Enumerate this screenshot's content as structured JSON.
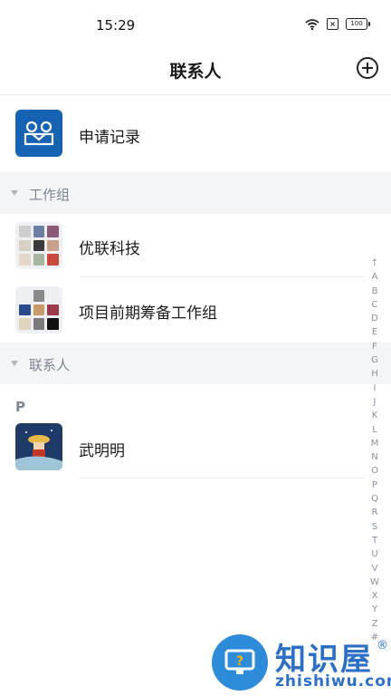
{
  "status_bar": {
    "time": "15:29",
    "battery": "100"
  },
  "header": {
    "title": "联系人"
  },
  "apply_record": {
    "label": "申请记录"
  },
  "sections": {
    "work_groups": {
      "title": "工作组"
    },
    "contacts": {
      "title": "联系人"
    }
  },
  "groups": [
    {
      "name": "优联科技"
    },
    {
      "name": "项目前期筹备工作组"
    }
  ],
  "contact_index_letter": "P",
  "contacts": [
    {
      "name": "武明明"
    }
  ],
  "alphabet": [
    "↑",
    "A",
    "B",
    "C",
    "D",
    "E",
    "F",
    "G",
    "H",
    "I",
    "J",
    "K",
    "L",
    "M",
    "N",
    "O",
    "P",
    "Q",
    "R",
    "S",
    "T",
    "U",
    "V",
    "W",
    "X",
    "Y",
    "Z",
    "#"
  ],
  "watermark": {
    "brand": "知识屋",
    "domain": "zhishiwu.com",
    "reg": "®"
  },
  "colors": {
    "accent": "#1663b4",
    "section_bg": "#f4f5f7",
    "muted_text": "#7d8593"
  }
}
